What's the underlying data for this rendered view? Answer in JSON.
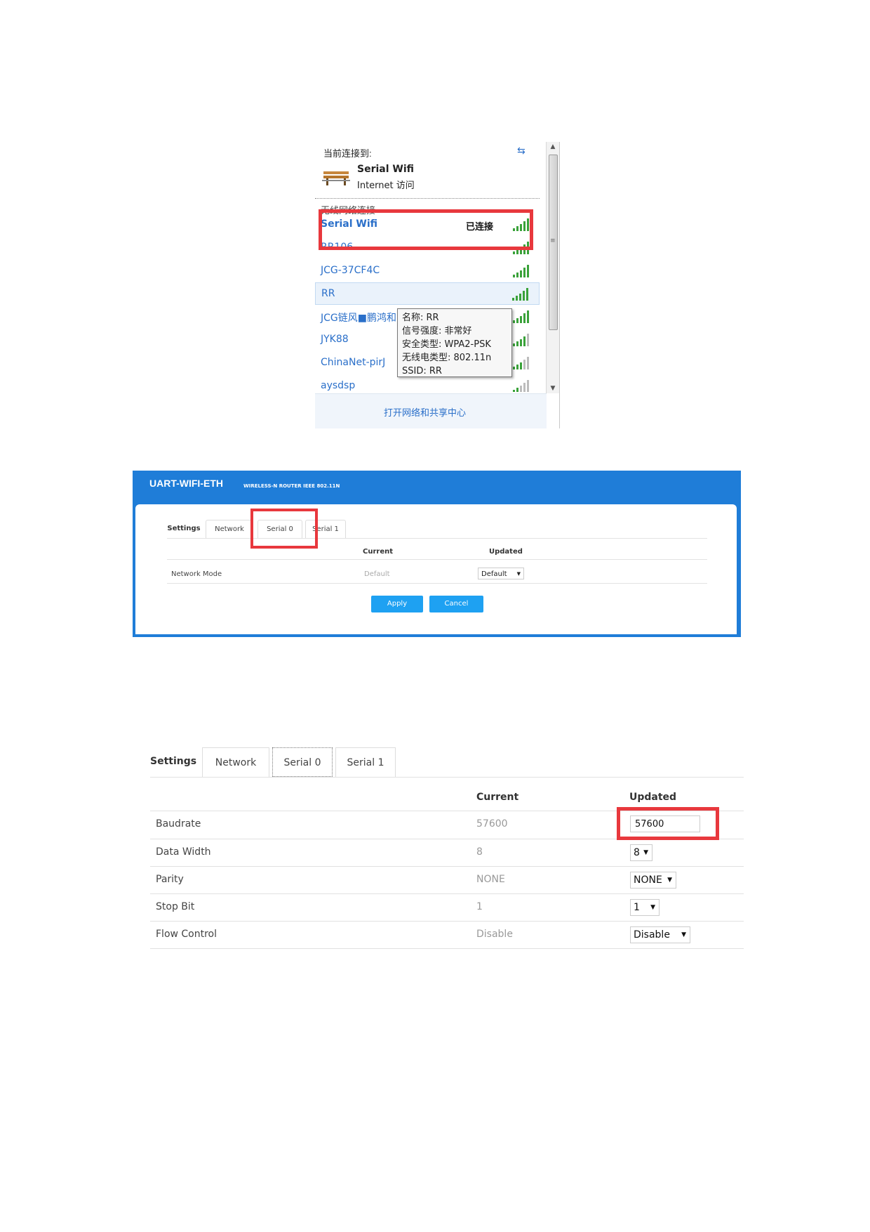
{
  "wifi_popup": {
    "current_label": "当前连接到:",
    "connected_name": "Serial Wifi",
    "connected_access": "Internet 访问",
    "section_heading": "无线网络连接",
    "networks": [
      {
        "name": "Serial Wifi",
        "status": "已连接",
        "signal": "full"
      },
      {
        "name": "RR106",
        "status": "",
        "signal": "full"
      },
      {
        "name": "JCG-37CF4C",
        "status": "",
        "signal": "full"
      },
      {
        "name": "RR",
        "status": "",
        "signal": "full"
      },
      {
        "name": "JCG链风■鹏鸿和",
        "status": "",
        "signal": "full"
      },
      {
        "name": "JYK88",
        "status": "",
        "signal": "good"
      },
      {
        "name": "ChinaNet-pirJ",
        "status": "",
        "signal": "good"
      },
      {
        "name": "aysdsp",
        "status": "",
        "signal": "good"
      }
    ],
    "tooltip": [
      "名称: RR",
      "信号强度: 非常好",
      "安全类型: WPA2-PSK",
      "无线电类型: 802.11n",
      "SSID: RR"
    ],
    "footer_link": "打开网络和共享中心"
  },
  "router": {
    "brand": "UART-WIFI-ETH",
    "subbrand": "WIRELESS-N ROUTER IEEE 802.11N",
    "tabs": {
      "settings": "Settings",
      "network": "Network",
      "serial0": "Serial 0",
      "serial1": "Serial 1"
    },
    "col_current": "Current",
    "col_updated": "Updated",
    "row_label": "Network Mode",
    "row_current": "Default",
    "row_updated": "Default",
    "apply": "Apply",
    "cancel": "Cancel",
    "accent": "#1f7dd8",
    "button_color": "#1ea1f2"
  },
  "serial": {
    "tabs": {
      "settings": "Settings",
      "network": "Network",
      "serial0": "Serial 0",
      "serial1": "Serial 1"
    },
    "col_current": "Current",
    "col_updated": "Updated",
    "rows": [
      {
        "label": "Baudrate",
        "current": "57600",
        "updated": "57600"
      },
      {
        "label": "Data Width",
        "current": "8",
        "updated": "8"
      },
      {
        "label": "Parity",
        "current": "NONE",
        "updated": "NONE"
      },
      {
        "label": "Stop Bit",
        "current": "1",
        "updated": "1"
      },
      {
        "label": "Flow Control",
        "current": "Disable",
        "updated": "Disable"
      }
    ]
  },
  "highlight_color": "#e8383d"
}
